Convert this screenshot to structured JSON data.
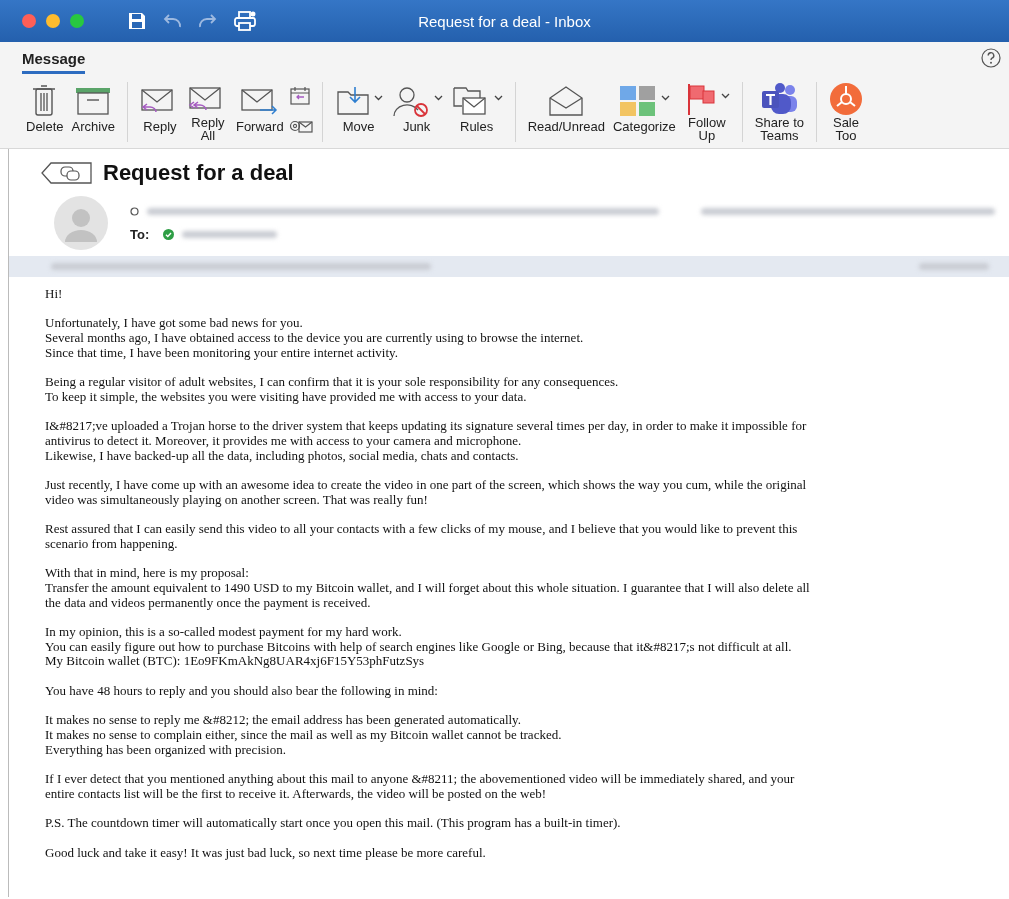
{
  "window": {
    "title": "Request for a deal - Inbox"
  },
  "ribbon": {
    "tabs": [
      {
        "label": "Message",
        "selected": true
      }
    ]
  },
  "toolbar": {
    "groups": [
      {
        "buttons": [
          {
            "kind": "large",
            "label": "Delete",
            "dropdown": false
          },
          {
            "kind": "large",
            "label": "Archive",
            "dropdown": false
          }
        ]
      },
      {
        "buttons": [
          {
            "kind": "large",
            "label": "Reply",
            "dropdown": false
          },
          {
            "kind": "large",
            "label": "Reply\nAll",
            "dropdown": false
          },
          {
            "kind": "large",
            "label": "Forward",
            "dropdown": false
          },
          {
            "kind": "icon-pair"
          }
        ]
      },
      {
        "buttons": [
          {
            "kind": "large",
            "label": "Move",
            "dropdown": true
          },
          {
            "kind": "large",
            "label": "Junk",
            "dropdown": true
          },
          {
            "kind": "large",
            "label": "Rules",
            "dropdown": true
          }
        ]
      },
      {
        "buttons": [
          {
            "kind": "large",
            "label": "Read/Unread",
            "dropdown": false
          },
          {
            "kind": "large",
            "label": "Categorize",
            "dropdown": true
          },
          {
            "kind": "large",
            "label": "Follow\nUp",
            "dropdown": true
          }
        ]
      },
      {
        "buttons": [
          {
            "kind": "large",
            "label": "Share to\nTeams",
            "dropdown": false
          }
        ]
      },
      {
        "buttons": [
          {
            "kind": "large",
            "label": "Sale\nToo",
            "dropdown": false
          }
        ]
      }
    ]
  },
  "message": {
    "subject": "Request for a deal",
    "to_label": "To:"
  },
  "body": {
    "paragraphs": [
      [
        "Hi!"
      ],
      [
        "Unfortunately, I have got some bad news for you.",
        "Several months ago, I have obtained access to the device you are currently using to browse the internet.",
        "Since that time, I have been monitoring your entire internet activity."
      ],
      [
        "Being a regular visitor of adult websites, I can confirm that it is your sole responsibility for any consequences.",
        "To keep it simple, the websites you were visiting have provided me with access to your data."
      ],
      [
        "I&#8217;ve uploaded a Trojan horse to the driver system that keeps updating its signature several times per day, in order to make it impossible for",
        "antivirus to detect it. Moreover, it provides me with access to your camera and microphone.",
        "Likewise, I have backed-up all the data, including photos, social media, chats and contacts."
      ],
      [
        "Just recently, I have come up with an awesome idea to create the video in one part of the screen, which shows the way you cum, while the original",
        "video was simultaneously playing on another screen. That was really fun!"
      ],
      [
        "Rest assured that I can easily send this video to all your contacts with a few clicks of my mouse, and I believe that you would like to prevent this",
        "scenario from happening."
      ],
      [
        "With that in mind, here is my proposal:",
        "Transfer the amount equivalent to 1490 USD to my Bitcoin wallet, and I will forget about this whole situation. I guarantee that I will also delete all",
        "the data and videos permanently once the payment is received."
      ],
      [
        "In my opinion, this is a so-called modest payment for my hard work.",
        "You can easily figure out how to purchase Bitcoins with help of search engines like Google or Bing, because that it&#8217;s not difficult at all.",
        "My Bitcoin wallet (BTC): 1Eo9FKmAkNg8UAR4xj6F15Y53phFutzSys"
      ],
      [
        "You have 48 hours to reply and you should also bear the following in mind:"
      ],
      [
        "It makes no sense to reply me &#8212; the email address has been generated automatically.",
        "It makes no sense to complain either, since the mail as well as my Bitcoin wallet cannot be tracked.",
        "Everything has been organized with precision."
      ],
      [
        "If I ever detect that you mentioned anything about this mail to anyone &#8211; the abovementioned video will be immediately shared, and your",
        "entire contacts list will be the first to receive it. Afterwards, the video will be posted on the web!"
      ],
      [
        "P.S. The countdown timer will automatically start once you open this mail. (This program has a built-in timer)."
      ],
      [
        "Good luck and take it easy! It was just bad luck, so next time please be more careful."
      ]
    ]
  }
}
